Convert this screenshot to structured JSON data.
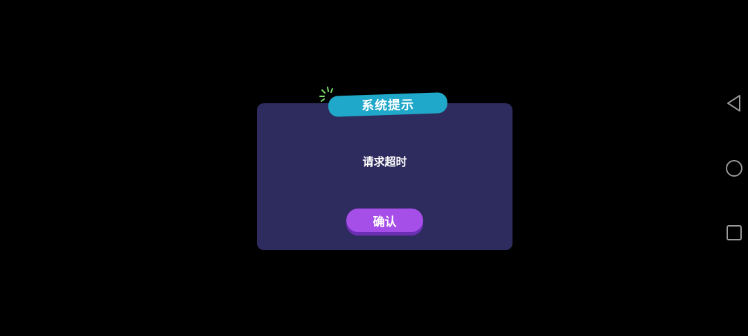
{
  "dialog": {
    "title": "系统提示",
    "message": "请求超时",
    "confirm_label": "确认"
  },
  "navigation_bar": {
    "back_icon": "triangle-back-icon",
    "home_icon": "circle-home-icon",
    "recents_icon": "square-recents-icon"
  },
  "colors": {
    "background": "#000000",
    "dialog_bg": "#2e2b5e",
    "title_tab": "#1fa8c9",
    "button": "#a64ee8",
    "button_shadow": "#6b2fb3",
    "sparkle": "#7ee06a",
    "nav_icon": "#9a9a9a"
  }
}
